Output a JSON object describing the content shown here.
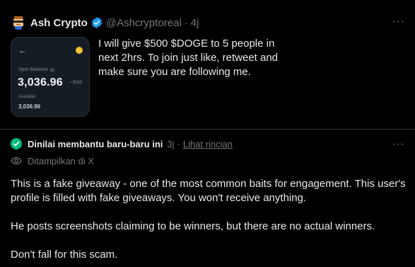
{
  "tweet": {
    "display_name": "Ash Crypto",
    "handle": "@Ashcryptoreal",
    "separator": "·",
    "time": "4j",
    "text": "I will give $500 $DOGE to 5 people in next 2hrs. To join just like, retweet and make sure you are following me.",
    "avatar_icon": "pixel-sunglasses-avatar",
    "verified_color": "#1d9bf0",
    "more_label": "···",
    "media": {
      "back_arrow": "←",
      "coin_icon": "doge-coin-icon",
      "balance_label": "Spot Balance",
      "balance_amount": "3,036.96",
      "approx_value": "≈ $566",
      "available_label": "Available",
      "available_amount": "3,036.96"
    }
  },
  "community_note": {
    "title": "Dinilai membantu baru-baru ini",
    "time": "3j",
    "separator": "·",
    "details_link": "Lihat rincian",
    "shown_label": "Ditampilkan di X",
    "more_label": "···",
    "check_color": "#00ba7c",
    "paragraphs": [
      "This is a fake giveaway - one of the most common baits for engagement. This user's profile is filled with fake giveaways. You won't receive anything.",
      "He posts screenshots claiming to be winners, but there are no actual winners.",
      "Don't fall for this scam."
    ]
  }
}
